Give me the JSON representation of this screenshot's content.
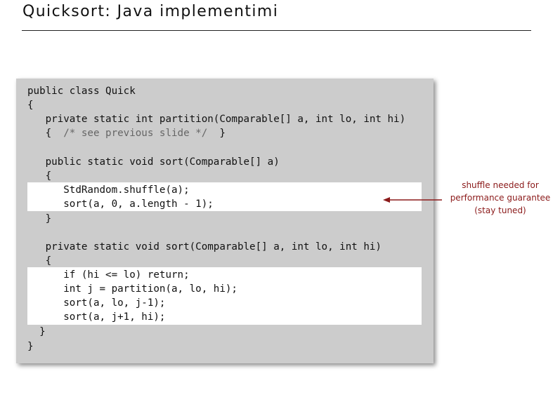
{
  "slide": {
    "title": "Quicksort: Java implementimi"
  },
  "code": {
    "lines": [
      "public class Quick",
      "{",
      "   private static int partition(Comparable[] a, int lo, int hi)",
      "   {  ",
      "   public static void sort(Comparable[] a)",
      "   {",
      "      StdRandom.shuffle(a);",
      "      sort(a, 0, a.length - 1);",
      "   }",
      "   private static void sort(Comparable[] a, int lo, int hi)",
      "   {",
      "      if (hi <= lo) return;",
      "      int j = partition(a, lo, hi);",
      "      sort(a, lo, j-1);",
      "      sort(a, j+1, hi);",
      "  }",
      "}"
    ],
    "comment": "/* see previous slide */",
    "comment_close": "  }"
  },
  "annotation": {
    "lines": [
      "shuffle needed for",
      "performance guarantee",
      "(stay tuned)"
    ]
  },
  "colors": {
    "panel_bg": "#cccccc",
    "highlight_bg": "#ffffff",
    "annotation": "#8b1a1a"
  }
}
